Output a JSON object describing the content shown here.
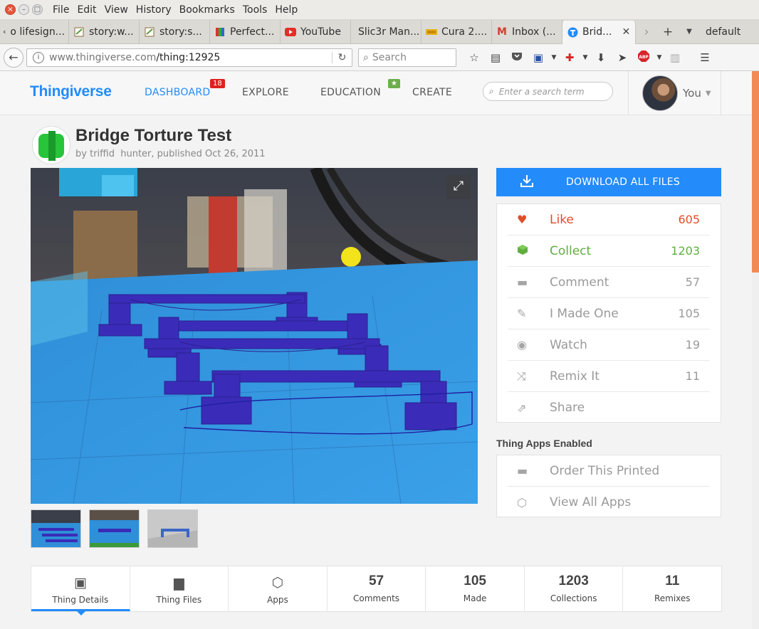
{
  "browser": {
    "menu": [
      "File",
      "Edit",
      "View",
      "History",
      "Bookmarks",
      "Tools",
      "Help"
    ],
    "tabs": [
      {
        "label": "o lifesign...",
        "icon": "back-arrow-icon"
      },
      {
        "label": "story:w...",
        "icon": "story-icon"
      },
      {
        "label": "story:s...",
        "icon": "story-icon"
      },
      {
        "label": "Perfect...",
        "icon": "perfect-icon"
      },
      {
        "label": "YouTube",
        "icon": "youtube-icon"
      },
      {
        "label": "Slic3r Man...",
        "icon": "page-icon"
      },
      {
        "label": "Cura 2....",
        "icon": "cura-icon"
      },
      {
        "label": "Inbox (...",
        "icon": "gmail-icon"
      },
      {
        "label": "Brid...",
        "icon": "thingiverse-icon",
        "active": true
      }
    ],
    "profile_label": "default",
    "url_host": "www.thingiverse.com",
    "url_path": "/thing:12925",
    "search_placeholder": "Search"
  },
  "site": {
    "logo": "Thingiverse",
    "nav": {
      "dashboard": "DASHBOARD",
      "dashboard_badge": "18",
      "explore": "EXPLORE",
      "education": "EDUCATION",
      "education_badge": "★",
      "create": "CREATE"
    },
    "search_placeholder": "Enter a search term",
    "user_label": "You"
  },
  "thing": {
    "title": "Bridge Torture Test",
    "by": "by",
    "author1": "triffid",
    "author2": "hunter",
    "published": ", published Oct 26, 2011"
  },
  "actions": {
    "download_label": "DOWNLOAD ALL FILES",
    "rows": [
      {
        "label": "Like",
        "count": "605",
        "icon": "heart-icon"
      },
      {
        "label": "Collect",
        "count": "1203",
        "icon": "cube-collect-icon"
      },
      {
        "label": "Comment",
        "count": "57",
        "icon": "comment-icon"
      },
      {
        "label": "I Made One",
        "count": "105",
        "icon": "edit-icon"
      },
      {
        "label": "Watch",
        "count": "19",
        "icon": "eye-icon"
      },
      {
        "label": "Remix It",
        "count": "11",
        "icon": "shuffle-icon"
      },
      {
        "label": "Share",
        "count": "",
        "icon": "share-icon"
      }
    ]
  },
  "apps": {
    "heading": "Thing Apps Enabled",
    "order": "Order This Printed",
    "view_all": "View All Apps"
  },
  "stats_tabs": {
    "details": "Thing Details",
    "files": "Thing Files",
    "apps": "Apps",
    "comments_num": "57",
    "comments": "Comments",
    "made_num": "105",
    "made": "Made",
    "collections_num": "1203",
    "collections": "Collections",
    "remixes_num": "11",
    "remixes": "Remixes"
  }
}
